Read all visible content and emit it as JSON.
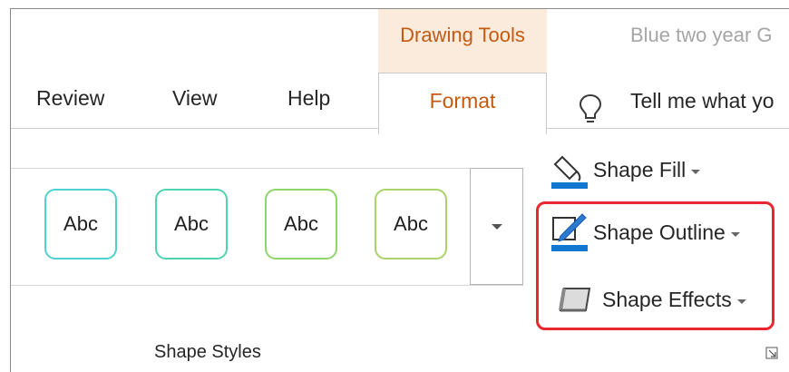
{
  "context_tab": {
    "label": "Drawing Tools"
  },
  "document": {
    "title": "Blue two year G"
  },
  "tabs": [
    {
      "label": "Review"
    },
    {
      "label": "View"
    },
    {
      "label": "Help"
    },
    {
      "label": "Format"
    }
  ],
  "tell_me": {
    "text": "Tell me what yo",
    "icon": "lightbulb-icon"
  },
  "shape_styles": {
    "gallery": [
      {
        "label": "Abc",
        "border_color": "#4fd1d1"
      },
      {
        "label": "Abc",
        "border_color": "#4fd3b0"
      },
      {
        "label": "Abc",
        "border_color": "#8fd66a"
      },
      {
        "label": "Abc",
        "border_color": "#a9d36a"
      }
    ],
    "group_label": "Shape Styles",
    "more_icon": "chevron-down-icon",
    "launcher_icon": "dialog-launcher-icon"
  },
  "commands": {
    "shape_fill": {
      "label": "Shape Fill",
      "icon": "paint-bucket-icon"
    },
    "shape_outline": {
      "label": "Shape Outline",
      "icon": "pen-icon"
    },
    "shape_effects": {
      "label": "Shape Effects",
      "icon": "effects-icon"
    }
  },
  "colors": {
    "accent": "#c45a11",
    "context_tab_bg": "#fbebdc",
    "highlight": "#e8272f",
    "fill_bar": "#1277d1",
    "outline_bar": "#1277d1"
  }
}
